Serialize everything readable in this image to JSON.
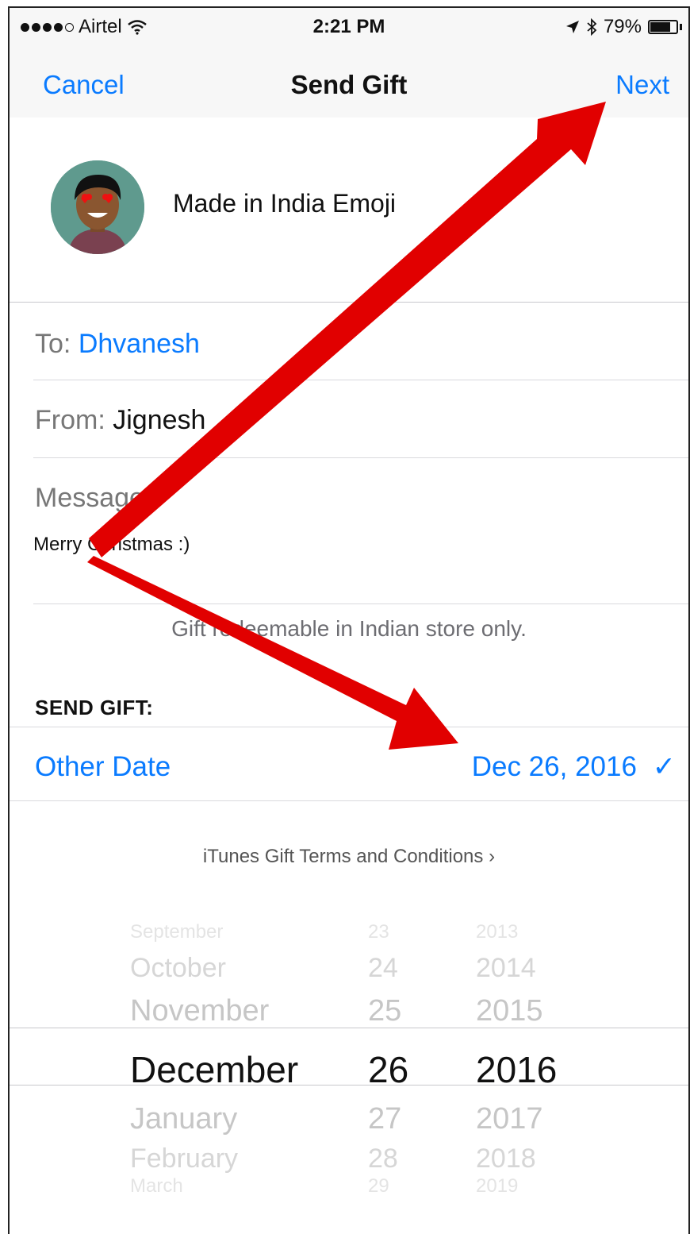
{
  "status_bar": {
    "carrier": "Airtel",
    "time": "2:21 PM",
    "battery_text": "79%",
    "battery_level": 0.79,
    "icons": [
      "signal-dots",
      "wifi-icon",
      "location-arrow-icon",
      "bluetooth-icon",
      "battery-icon"
    ]
  },
  "nav": {
    "cancel": "Cancel",
    "title": "Send Gift",
    "next": "Next"
  },
  "gift": {
    "name": "Made in India Emoji"
  },
  "form": {
    "to_label": "To:",
    "to_value": "Dhvanesh",
    "from_label": "From:",
    "from_value": "Jignesh",
    "message_label": "Message:",
    "message_value": "Merry Christmas :)"
  },
  "notice": "Gift redeemable in Indian store only.",
  "send_gift": {
    "header": "SEND GIFT:",
    "other_date": "Other Date",
    "selected_date": "Dec 26, 2016",
    "check": "✓"
  },
  "terms": "iTunes Gift Terms and Conditions",
  "terms_chevron": "›",
  "picker": {
    "months": [
      "September",
      "October",
      "November",
      "December",
      "January",
      "February",
      "March"
    ],
    "days": [
      "23",
      "24",
      "25",
      "26",
      "27",
      "28",
      "29"
    ],
    "years": [
      "2013",
      "2014",
      "2015",
      "2016",
      "2017",
      "2018",
      "2019"
    ],
    "selected_index": 3
  },
  "colors": {
    "accent": "#0a7bff",
    "annotation_arrow": "#e10000"
  }
}
